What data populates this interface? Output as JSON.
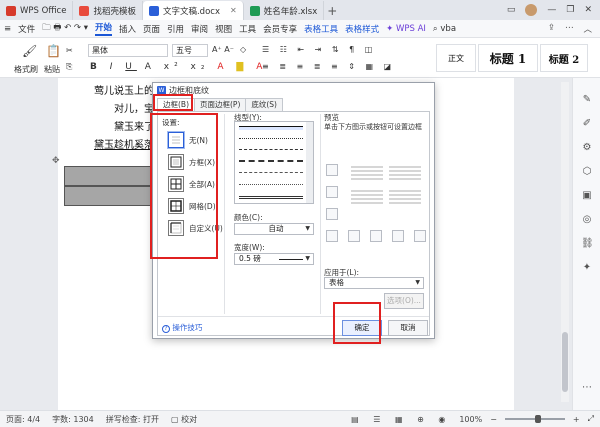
{
  "tabs": [
    {
      "label": "WPS Office",
      "color": "#d63a2b"
    },
    {
      "label": "找稻壳模板",
      "color": "#e84b3c"
    },
    {
      "label": "文字文稿.docx",
      "color": "#2b5fd8"
    },
    {
      "label": "姓名年龄.xlsx",
      "color": "#1e9b54"
    }
  ],
  "menu": {
    "file": "文件",
    "items": [
      "开始",
      "插入",
      "页面",
      "引用",
      "审阅",
      "视图",
      "工具",
      "会员专享"
    ],
    "context": [
      "表格工具",
      "表格样式"
    ],
    "ai": "WPS AI",
    "vba": "vba"
  },
  "ribbon": {
    "format_painter": "格式刷",
    "paste": "粘贴",
    "font_name": "黑体",
    "font_size": "五号",
    "styles": [
      "正文",
      "标题 1",
      "标题 2"
    ]
  },
  "doc": {
    "lines": [
      "莺儿说玉上的",
      "对儿，宝",
      "黛玉来了",
      "黛玉趁机奚落"
    ]
  },
  "dialog": {
    "title": "边框和底纹",
    "tabs": [
      "边框(B)",
      "页面边框(P)",
      "底纹(S)"
    ],
    "settings_label": "设置:",
    "settings": [
      "无(N)",
      "方框(X)",
      "全部(A)",
      "网格(D)",
      "自定义(U)"
    ],
    "line_style_label": "线型(Y):",
    "color_label": "颜色(C):",
    "color_value": "自动",
    "width_label": "宽度(W):",
    "width_value": "0.5  磅",
    "preview_label": "预览",
    "preview_hint": "单击下方图示或按钮可设置边框",
    "apply_label": "应用于(L):",
    "apply_value": "表格",
    "options_button": "选项(O)...",
    "tips": "操作技巧",
    "ok": "确定",
    "cancel": "取消"
  },
  "status": {
    "page": "页面: 4/4",
    "words": "字数: 1304",
    "spell": "拼写检查: 打开",
    "proof": "校对",
    "zoom": "100%"
  },
  "colors": {
    "accent": "#2b5fd8",
    "highlight": "#e02020"
  }
}
